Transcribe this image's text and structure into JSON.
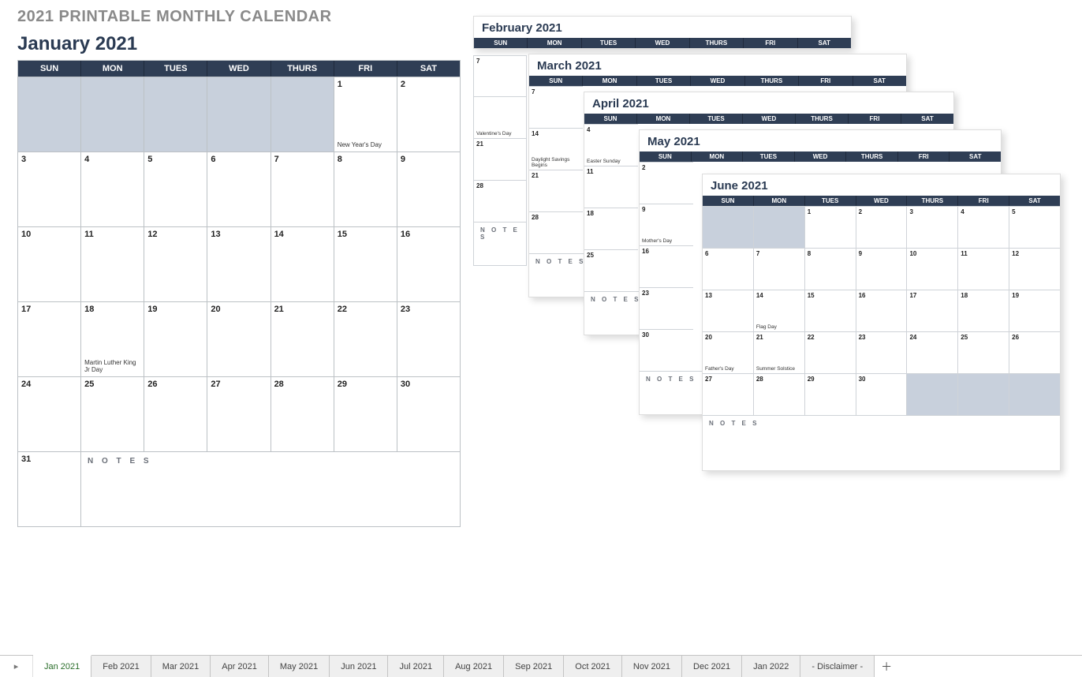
{
  "title_main": "2021 PRINTABLE MONTHLY CALENDAR",
  "notes_label": "N O T E S",
  "day_headers": [
    "SUN",
    "MON",
    "TUES",
    "WED",
    "THURS",
    "FRI",
    "SAT"
  ],
  "january": {
    "title": "January 2021",
    "weeks": [
      [
        {
          "s": 1
        },
        {
          "s": 1
        },
        {
          "s": 1
        },
        {
          "s": 1
        },
        {
          "s": 1
        },
        {
          "n": "1",
          "e": "New Year's Day"
        },
        {
          "n": "2"
        }
      ],
      [
        {
          "n": "3"
        },
        {
          "n": "4"
        },
        {
          "n": "5"
        },
        {
          "n": "6"
        },
        {
          "n": "7"
        },
        {
          "n": "8"
        },
        {
          "n": "9"
        }
      ],
      [
        {
          "n": "10"
        },
        {
          "n": "11"
        },
        {
          "n": "12"
        },
        {
          "n": "13"
        },
        {
          "n": "14"
        },
        {
          "n": "15"
        },
        {
          "n": "16"
        }
      ],
      [
        {
          "n": "17"
        },
        {
          "n": "18",
          "e": "Martin Luther King Jr Day"
        },
        {
          "n": "19"
        },
        {
          "n": "20"
        },
        {
          "n": "21"
        },
        {
          "n": "22"
        },
        {
          "n": "23"
        }
      ],
      [
        {
          "n": "24"
        },
        {
          "n": "25"
        },
        {
          "n": "26"
        },
        {
          "n": "27"
        },
        {
          "n": "28"
        },
        {
          "n": "29"
        },
        {
          "n": "30"
        }
      ]
    ],
    "extra": "31"
  },
  "feb": {
    "title": "February 2021",
    "rows": [
      [
        {
          "n": "7"
        }
      ],
      [
        {
          "n": "",
          "e": "Valentine's Day"
        }
      ],
      []
    ]
  },
  "mar": {
    "title": "March 2021",
    "leftcol": [
      {
        "n": "7"
      },
      {
        "n": "14",
        "e": "Daylight Savings Begins"
      },
      {
        "n": "21"
      },
      {
        "n": "28"
      }
    ]
  },
  "apr": {
    "title": "April 2021",
    "leftcol": [
      {
        "n": "4",
        "e": "Easter Sunday"
      },
      {
        "n": "11"
      },
      {
        "n": "18"
      },
      {
        "n": "25"
      }
    ]
  },
  "may": {
    "title": "May 2021",
    "leftcol": [
      {
        "n": "2"
      },
      {
        "n": "9",
        "e": "Mother's Day"
      },
      {
        "n": "16"
      },
      {
        "n": "23"
      },
      {
        "n": "30"
      }
    ]
  },
  "jun": {
    "title": "June 2021",
    "weeks": [
      [
        {
          "s": 1
        },
        {
          "s": 1
        },
        {
          "n": "1"
        },
        {
          "n": "2"
        },
        {
          "n": "3"
        },
        {
          "n": "4"
        },
        {
          "n": "5"
        }
      ],
      [
        {
          "n": "6"
        },
        {
          "n": "7"
        },
        {
          "n": "8"
        },
        {
          "n": "9"
        },
        {
          "n": "10"
        },
        {
          "n": "11"
        },
        {
          "n": "12"
        }
      ],
      [
        {
          "n": "13"
        },
        {
          "n": "14",
          "e": "Flag Day"
        },
        {
          "n": "15"
        },
        {
          "n": "16"
        },
        {
          "n": "17"
        },
        {
          "n": "18"
        },
        {
          "n": "19"
        }
      ],
      [
        {
          "n": "20",
          "e": "Father's  Day"
        },
        {
          "n": "21",
          "e": "Summer Solstice"
        },
        {
          "n": "22"
        },
        {
          "n": "23"
        },
        {
          "n": "24"
        },
        {
          "n": "25"
        },
        {
          "n": "26"
        }
      ],
      [
        {
          "n": "27"
        },
        {
          "n": "28"
        },
        {
          "n": "29"
        },
        {
          "n": "30"
        },
        {
          "s": 1
        },
        {
          "s": 1
        },
        {
          "s": 1
        }
      ]
    ]
  },
  "tabs": [
    {
      "label": "Jan 2021",
      "active": true
    },
    {
      "label": "Feb 2021"
    },
    {
      "label": "Mar 2021"
    },
    {
      "label": "Apr 2021"
    },
    {
      "label": "May 2021"
    },
    {
      "label": "Jun 2021"
    },
    {
      "label": "Jul 2021"
    },
    {
      "label": "Aug 2021"
    },
    {
      "label": "Sep 2021"
    },
    {
      "label": "Oct 2021"
    },
    {
      "label": "Nov 2021"
    },
    {
      "label": "Dec 2021"
    },
    {
      "label": "Jan 2022"
    },
    {
      "label": "- Disclaimer -"
    }
  ]
}
